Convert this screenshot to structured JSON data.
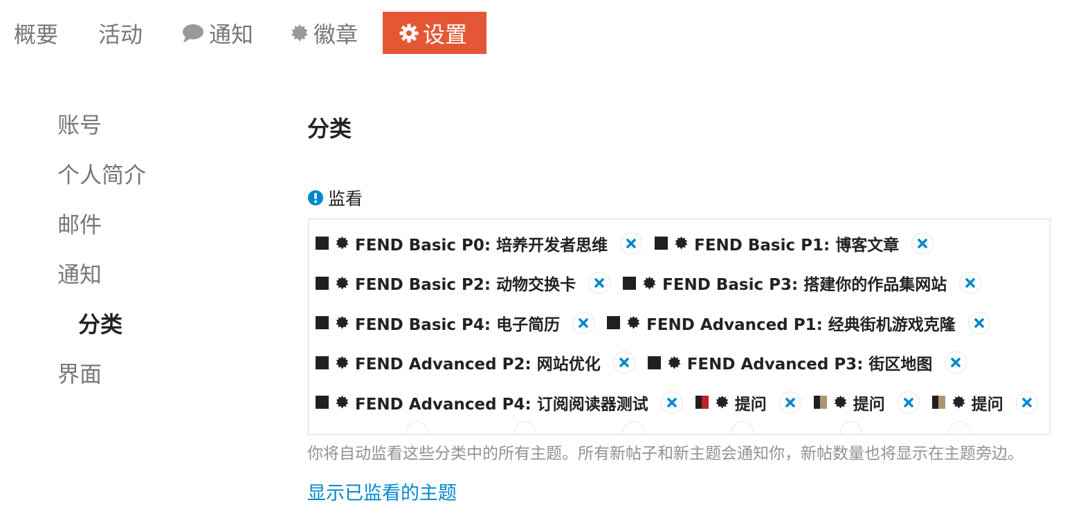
{
  "colors": {
    "accent": "#e45735",
    "link": "#0088cc",
    "remove_x": "#0088cc",
    "muted_text": "#919191"
  },
  "top_nav": {
    "summary": "概要",
    "activity": "活动",
    "notifications": "通知",
    "badges": "徽章",
    "settings": "设置",
    "icons": {
      "notifications": "comment-icon",
      "badges": "certificate-icon",
      "settings": "gear-icon"
    }
  },
  "sub_nav": {
    "account": "账号",
    "profile": "个人简介",
    "emails": "邮件",
    "notifications": "通知",
    "categories": "分类",
    "interface": "界面"
  },
  "main": {
    "title": "分类",
    "watch_label": "监看",
    "watch_icon": "exclamation-circle-icon",
    "description": "你将自动监看这些分类中的所有主题。所有新帖子和新主题会通知你，新帖数量也将显示在主题旁边。",
    "show_link": "显示已监看的主题",
    "categories": [
      {
        "name": "FEND Basic P0: 培养开发者思维",
        "color_left": "#231f20",
        "color_right": "#231f20"
      },
      {
        "name": "FEND Basic P1: 博客文章",
        "color_left": "#231f20",
        "color_right": "#231f20"
      },
      {
        "name": "FEND Basic P2: 动物交换卡",
        "color_left": "#231f20",
        "color_right": "#231f20"
      },
      {
        "name": "FEND Basic P3: 搭建你的作品集网站",
        "color_left": "#231f20",
        "color_right": "#231f20"
      },
      {
        "name": "FEND Basic P4: 电子简历",
        "color_left": "#231f20",
        "color_right": "#231f20"
      },
      {
        "name": "FEND Advanced P1: 经典街机游戏克隆",
        "color_left": "#231f20",
        "color_right": "#231f20"
      },
      {
        "name": "FEND Advanced P2: 网站优化",
        "color_left": "#231f20",
        "color_right": "#231f20"
      },
      {
        "name": "FEND Advanced P3: 街区地图",
        "color_left": "#231f20",
        "color_right": "#231f20"
      },
      {
        "name": "FEND Advanced P4: 订阅阅读器测试",
        "color_left": "#231f20",
        "color_right": "#231f20"
      },
      {
        "name": "提问",
        "color_left": "#231f20",
        "color_right": "#c0202a"
      },
      {
        "name": "提问",
        "color_left": "#231f20",
        "color_right": "#aa9772"
      },
      {
        "name": "提问",
        "color_left": "#231f20",
        "color_right": "#aa9772"
      }
    ]
  }
}
